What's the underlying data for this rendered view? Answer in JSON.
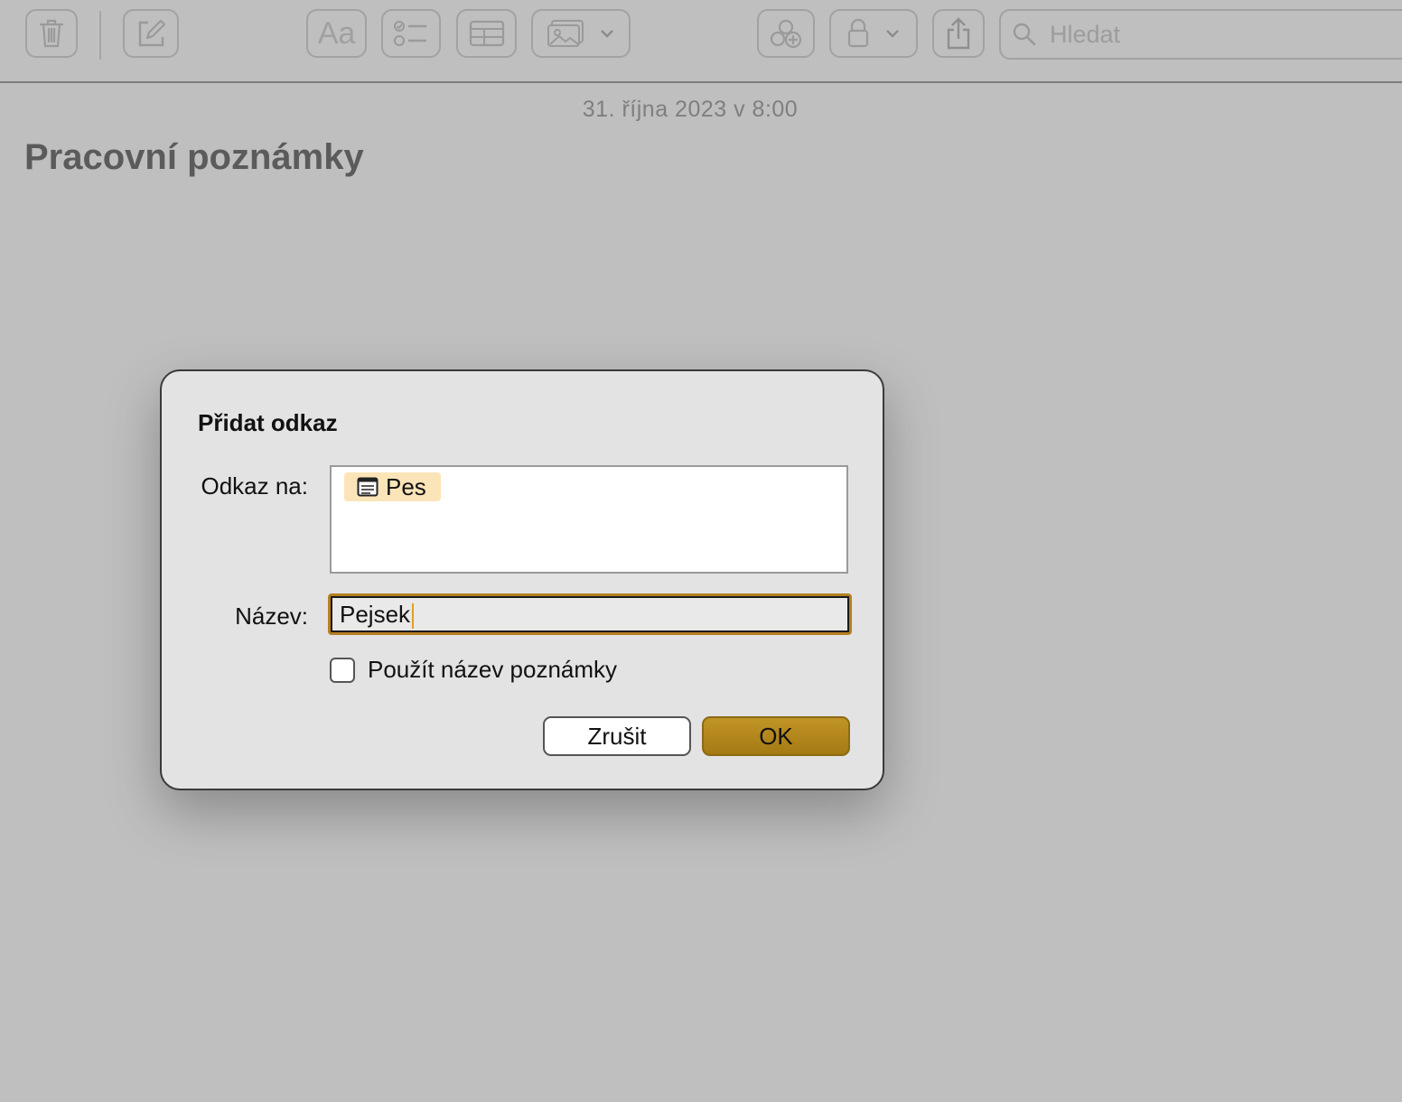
{
  "toolbar": {
    "buttons": [
      {
        "name": "delete",
        "icon": "trash-icon"
      },
      {
        "name": "compose",
        "icon": "compose-icon"
      },
      {
        "name": "format",
        "icon": "text-format-icon",
        "label": "Aa"
      },
      {
        "name": "checklist",
        "icon": "checklist-icon"
      },
      {
        "name": "table",
        "icon": "table-icon"
      },
      {
        "name": "media",
        "icon": "photo-icon"
      },
      {
        "name": "collaborate",
        "icon": "collaborate-icon"
      },
      {
        "name": "lock",
        "icon": "lock-icon"
      },
      {
        "name": "share",
        "icon": "share-icon"
      }
    ],
    "search_placeholder": "Hledat"
  },
  "note": {
    "date": "31. října 2023 v 8:00",
    "title": "Pracovní poznámky"
  },
  "dialog": {
    "title": "Přidat odkaz",
    "link_label": "Odkaz na:",
    "link_token": "Pes",
    "name_label": "Název:",
    "name_value": "Pejsek",
    "checkbox_label": "Použít název poznámky",
    "checkbox_checked": false,
    "cancel_label": "Zrušit",
    "ok_label": "OK"
  },
  "colors": {
    "accent": "#b57f22",
    "ok_button": "#b08618",
    "token_bg": "#fbe4b8"
  }
}
